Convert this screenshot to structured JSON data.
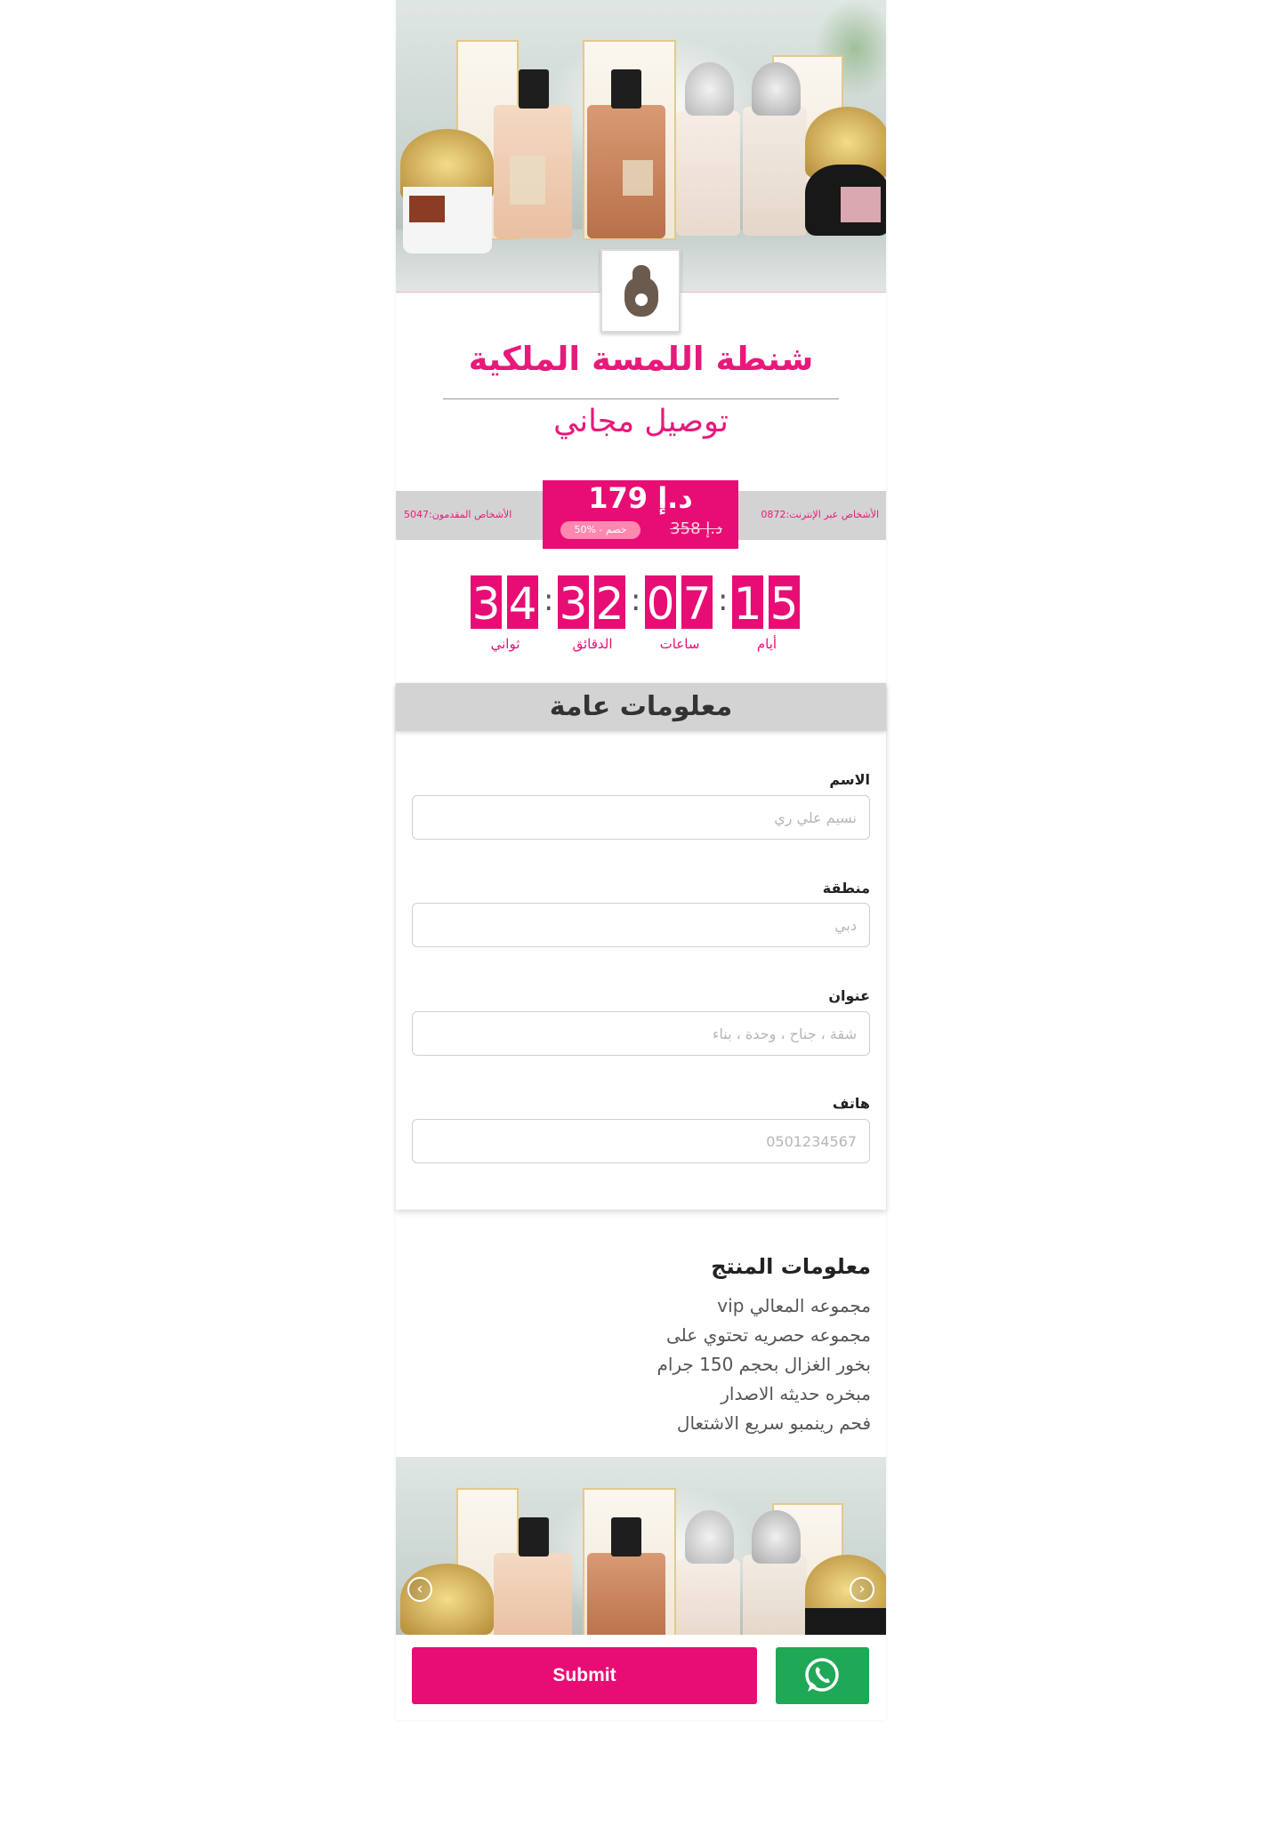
{
  "brand": {
    "title": "شنطة اللمسة الملكية",
    "subtitle": "توصيل مجاني"
  },
  "stats": {
    "online": "الأشخاص عبر الإنترنت:0872",
    "applicants": "الأشخاص المقدمون:5047"
  },
  "price": {
    "current": "179 د.إ",
    "old": "358 د.إ",
    "discount": "50% - خصم"
  },
  "countdown": {
    "seconds": [
      "3",
      "4"
    ],
    "minutes": [
      "3",
      "2"
    ],
    "hours": [
      "0",
      "7"
    ],
    "days": [
      "1",
      "5"
    ],
    "labels": {
      "seconds": "ثواني",
      "minutes": "الدقائق",
      "hours": "ساعات",
      "days": "أيام"
    }
  },
  "form": {
    "heading": "معلومات عامة",
    "fields": [
      {
        "label": "الاسم",
        "placeholder": "نسيم علي ري",
        "value": ""
      },
      {
        "label": "منطقة",
        "placeholder": "دبي",
        "value": ""
      },
      {
        "label": "عنوان",
        "placeholder": "شقة ، جناح ، وحدة ، بناء",
        "value": ""
      },
      {
        "label": "هاتف",
        "placeholder": "0501234567",
        "value": ""
      }
    ]
  },
  "product_info": {
    "title": "معلومات المنتج",
    "lines": [
      "مجموعه المعالي vip",
      "مجموعه حصريه تحتوي على",
      "بخور الغزال بحجم 150 جرام",
      "مبخره حديثه الاصدار",
      "فحم رينمبو سريع الاشتعال"
    ]
  },
  "actions": {
    "submit_label": "Submit",
    "whatsapp_icon": "whatsapp-icon"
  },
  "colors": {
    "accent": "#e80d74",
    "whatsapp": "#1fa855",
    "bar_gray": "#d3d3d3"
  }
}
